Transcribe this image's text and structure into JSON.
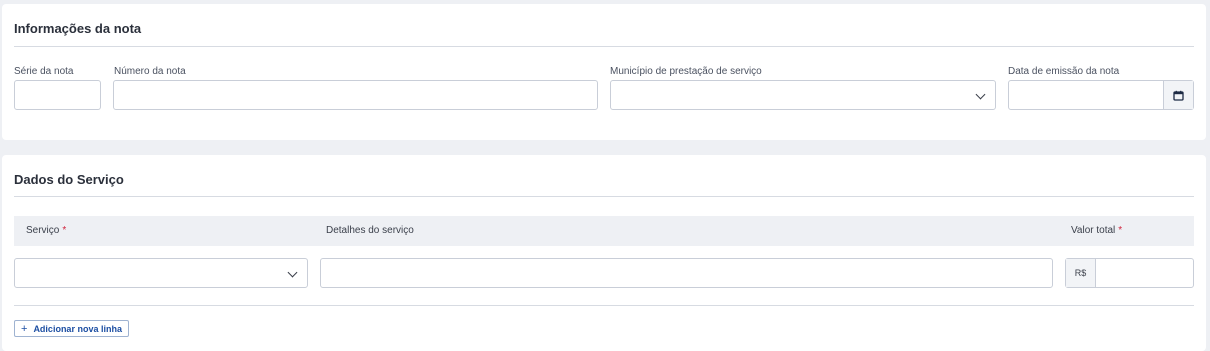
{
  "nota": {
    "title": "Informações da nota",
    "serie_label": "Série da nota",
    "numero_label": "Número da nota",
    "municipio_label": "Município de prestação de serviço",
    "data_label": "Data de emissão da nota",
    "serie_value": "",
    "numero_value": "",
    "municipio_value": "",
    "data_value": ""
  },
  "servico": {
    "title": "Dados do Serviço",
    "col_servico": "Serviço",
    "col_detalhes": "Detalhes do serviço",
    "col_valor": "Valor total",
    "required_mark": "*",
    "currency_prefix": "R$",
    "servico_value": "",
    "detalhes_value": "",
    "valor_value": "",
    "add_line_label": "Adicionar nova linha",
    "add_icon": "+"
  },
  "colors": {
    "accent": "#1d4fa3",
    "required": "#d0233c",
    "background": "#eef0f4"
  }
}
